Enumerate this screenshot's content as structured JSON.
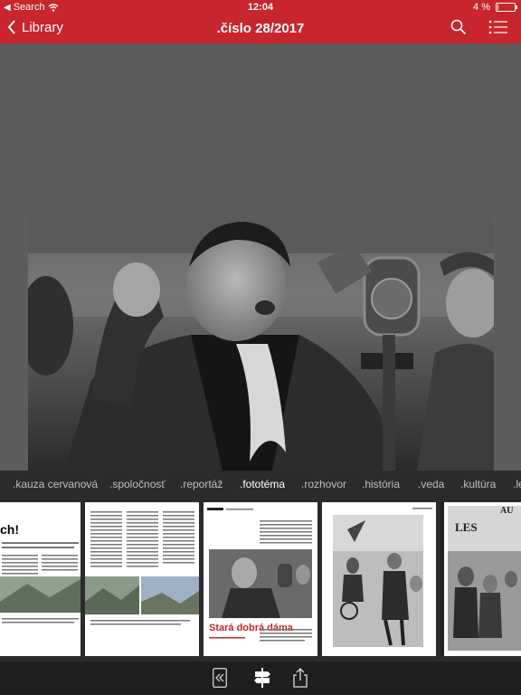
{
  "status_bar": {
    "carrier": "Search",
    "time": "12:04",
    "battery_text": "4 %",
    "battery_level": 0.04
  },
  "nav": {
    "back_label": "Library",
    "title": ".číslo 28/2017"
  },
  "sections": [
    ".kauza cervanová",
    ".spoločnosť",
    ".reportáž",
    ".fototéma",
    ".rozhovor",
    ".história",
    ".veda",
    ".kultúra",
    ".le"
  ],
  "active_section": ".fototéma",
  "page3": {
    "headline": "Stará dobrá dáma",
    "header_mark": "FOTOTÉMA"
  },
  "page1": {
    "headline_fragment": "ch!"
  },
  "page5": {
    "sign_text": "LES",
    "sign_text2": "AU"
  },
  "colors": {
    "accent": "#c8252c",
    "toolbar": "#1e1e1e",
    "strip": "#2b2b2b"
  },
  "toolbar": {
    "icons": [
      "rewind-icon",
      "signpost-icon",
      "share-icon"
    ]
  }
}
